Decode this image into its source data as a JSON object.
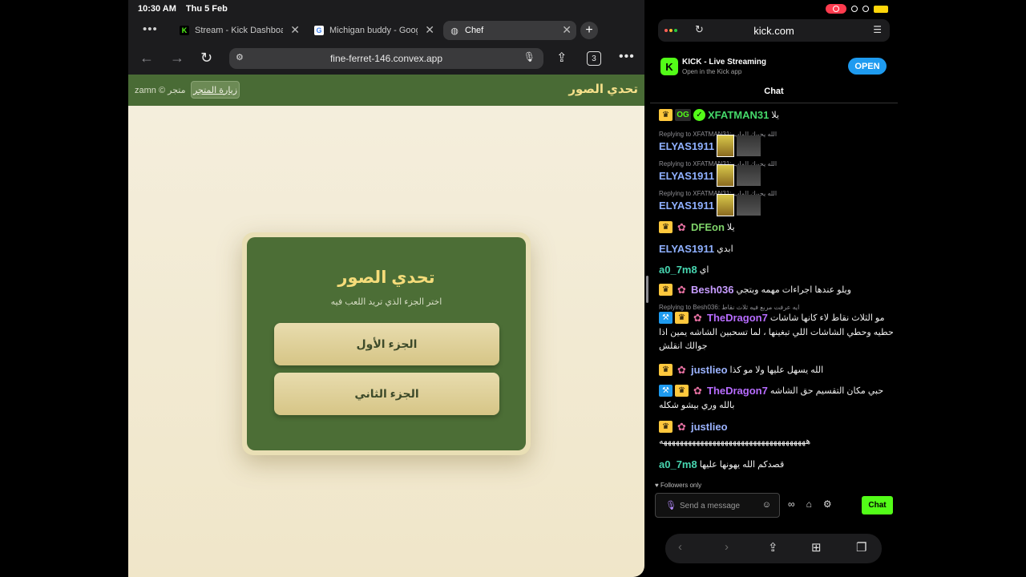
{
  "status": {
    "time": "10:30 AM",
    "date": "Thu 5 Feb"
  },
  "safari": {
    "tabs": [
      {
        "label": "Stream - Kick Dashboard",
        "favicon": "K"
      },
      {
        "label": "Michigan buddy - Google",
        "favicon": "G"
      },
      {
        "label": "Chef",
        "favicon": "globe"
      }
    ],
    "url": "fine-ferret-146.convex.app",
    "tab_count": "3"
  },
  "site": {
    "header_title": "تحدي الصور",
    "visit_store": "زيارة المتجر",
    "store_credit": "zamn © متجر",
    "card_title": "تحدي الصور",
    "card_subtitle": "اختر الجزء الذي تريد اللعب فيه",
    "part_one": "الجزء الأول",
    "part_two": "الجزء الثاني"
  },
  "kick": {
    "url": "kick.com",
    "banner_title": "KICK - Live Streaming",
    "banner_sub": "Open in the Kick app",
    "open_label": "OPEN",
    "chat_title": "Chat",
    "messages": [
      {
        "user": "XFATMAN31",
        "text": "يلا",
        "reply": ""
      },
      {
        "user": "ELYAS1911",
        "text": "",
        "reply": "Replying to XFATMAN31: الله يحييك الماب"
      },
      {
        "user": "ELYAS1911",
        "text": "",
        "reply": "Replying to XFATMAN31: الله يحييك الماب"
      },
      {
        "user": "ELYAS1911",
        "text": "",
        "reply": "Replying to XFATMAN31: الله يحييك الماب"
      },
      {
        "user": "DFEon",
        "text": "يلا",
        "reply": ""
      },
      {
        "user": "ELYAS1911",
        "text": "ابدي",
        "reply": ""
      },
      {
        "user": "a0_7m8",
        "text": "اي",
        "reply": ""
      },
      {
        "user": "Besh036",
        "text": "ويلو عندها اجراءات مهمه وبتجي",
        "reply": ""
      },
      {
        "user": "TheDragon7",
        "text": "مو الثلاث نقاط لاء كانها شاشات",
        "text2": "حطيه وحطي الشاشات اللي تبغينها ، لما تسحبين الشاشه يمين اذا",
        "text3": "جوالك انقلش",
        "reply": "Replying to Besh036: ايه عرفت مربع فيه ثلاث نقاط"
      },
      {
        "user": "justlieo",
        "text": "الله يسهل عليها ولا مو كذا",
        "reply": ""
      },
      {
        "user": "TheDragon7",
        "text": "حبي مكان التقسيم حق الشاشه",
        "text2": "بالله وري بيشو شكله",
        "reply": ""
      },
      {
        "user": "justlieo",
        "text": "",
        "text2": "ههههههههههههههههههههههههههههههههههههه",
        "reply": ""
      },
      {
        "user": "a0_7m8",
        "text": "قصدكم الله يهونها عليها",
        "reply": ""
      }
    ],
    "followers_only": "Followers only",
    "input_placeholder": "Send a message",
    "send_label": "Chat"
  },
  "colors": {
    "site_green": "#496b35",
    "kick_green": "#53fc18",
    "gold": "#f5dc7a"
  }
}
